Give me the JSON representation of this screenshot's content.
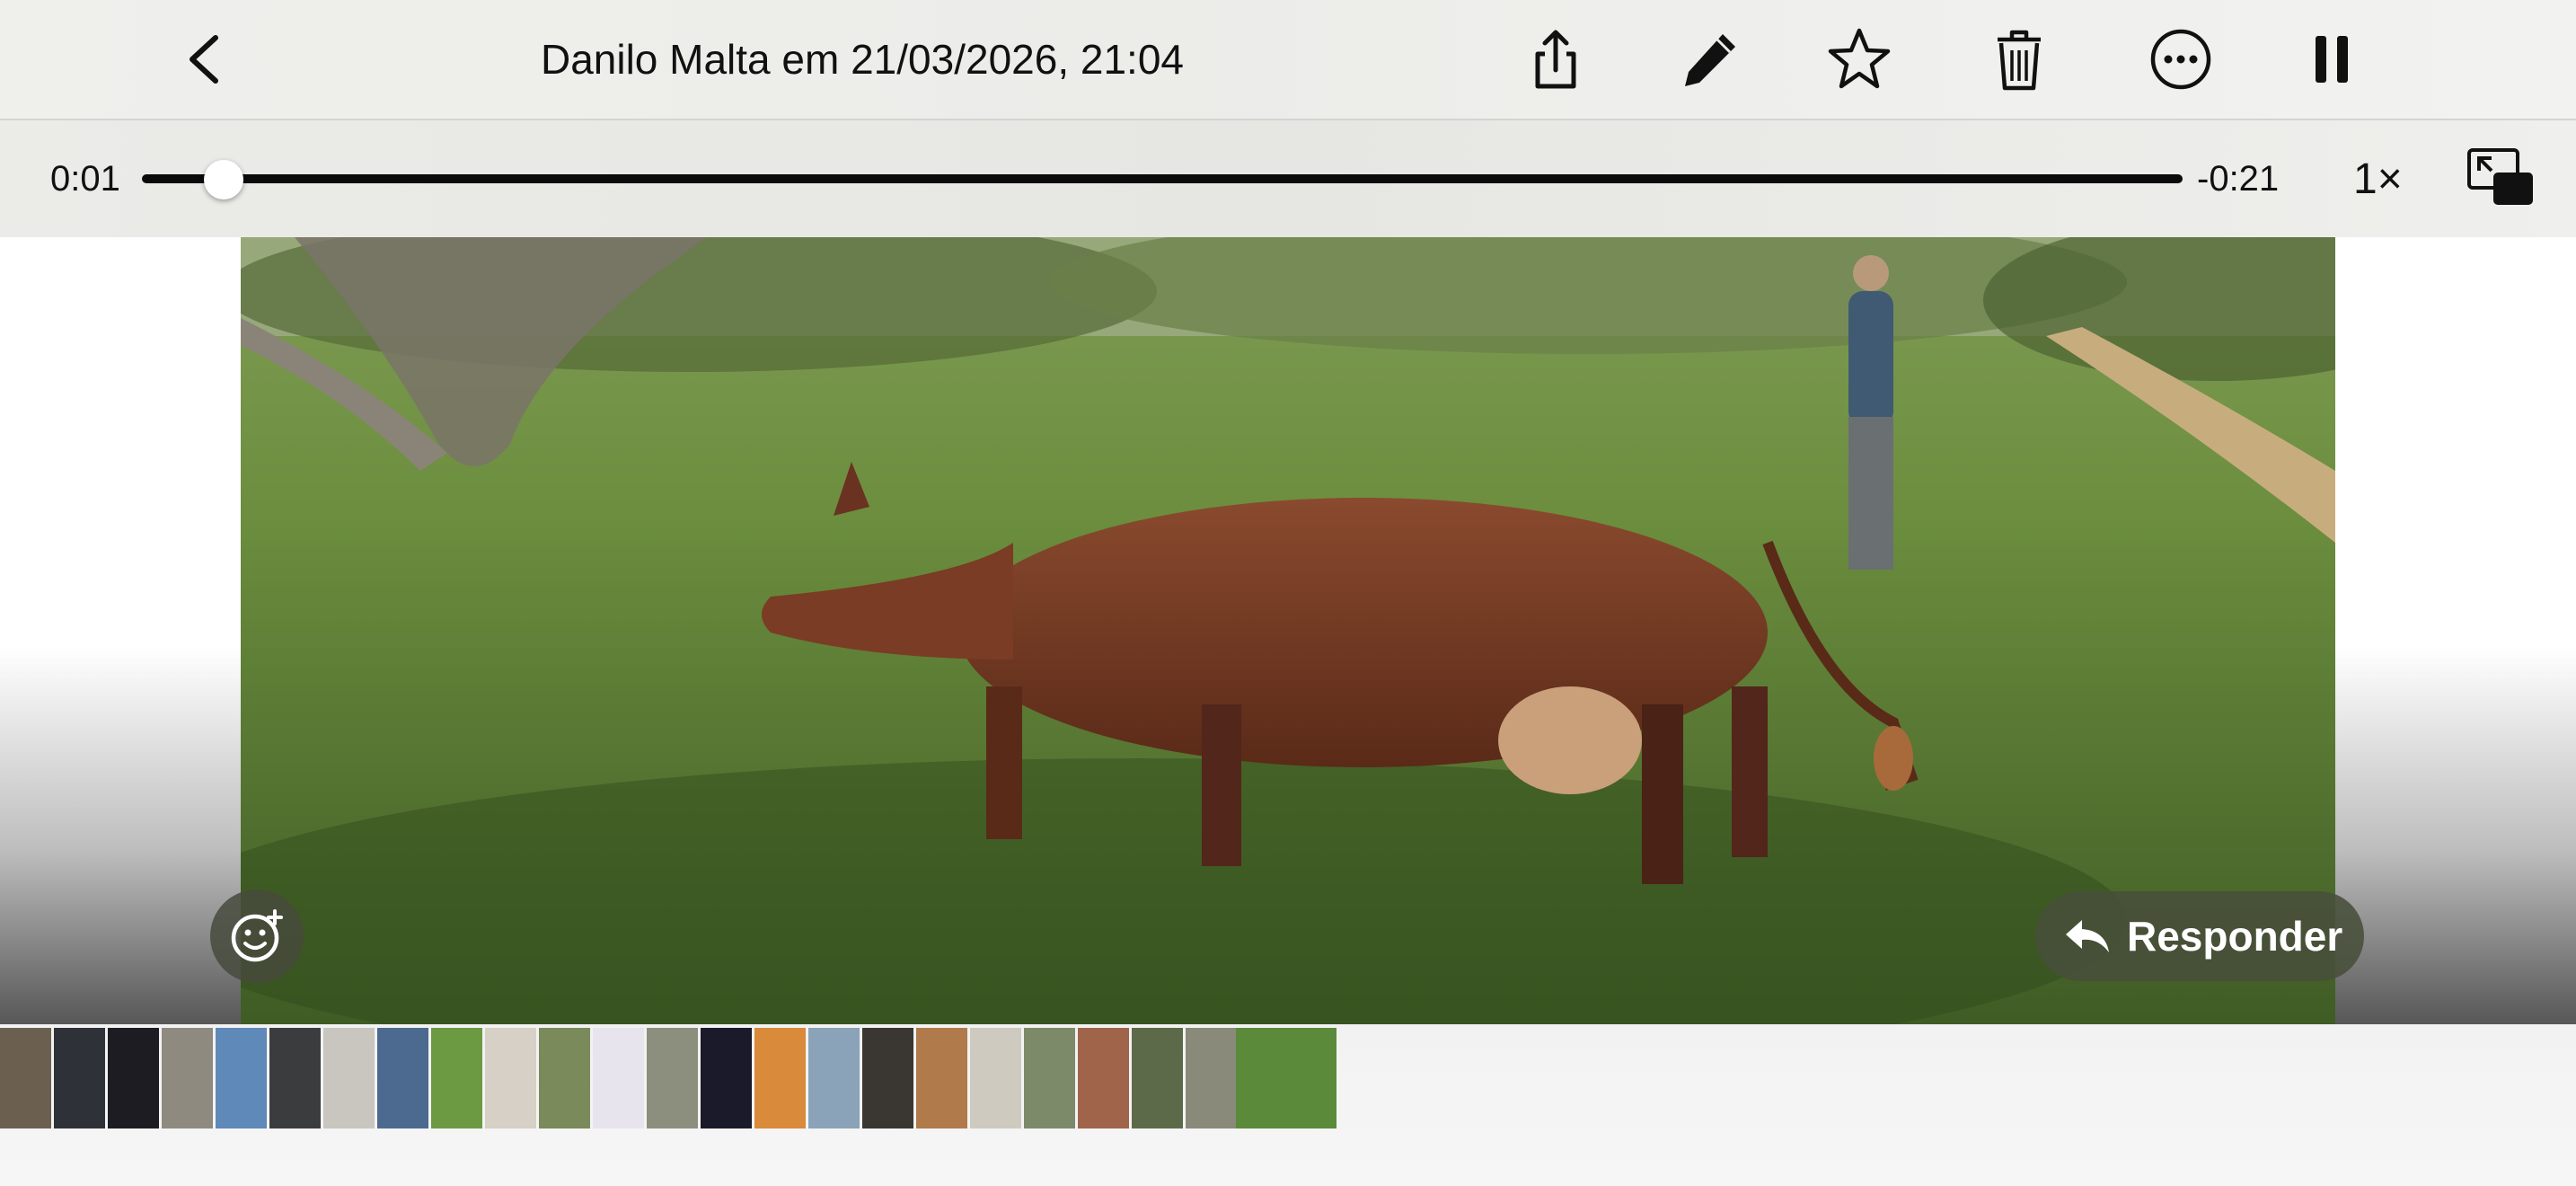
{
  "header": {
    "back_label": "Back",
    "title": "Danilo Malta em 21/03/2026, 21:04",
    "actions": [
      "share-icon",
      "edit-pencil-icon",
      "favorite-star-icon",
      "trash-icon",
      "more-ellipsis-icon",
      "pause-icon"
    ]
  },
  "player": {
    "elapsed": "0:01",
    "remaining": "-0:21",
    "progress": 0.04,
    "speed": "1×",
    "pip_icon": "picture-in-picture-icon"
  },
  "overlay": {
    "reply_label": "Responder",
    "reply_icon": "reply-arrow-icon",
    "react_icon": "add-reaction-icon"
  },
  "strip": {
    "thumbs": [
      "#6b6050",
      "#2e3238",
      "#1c1c22",
      "#8e8a80",
      "#5f89b8",
      "#3a3c3e",
      "#c9c6c0",
      "#4c6a90",
      "#6b9a42",
      "#d6d0c6",
      "#7a8a5a",
      "#e8e4ee",
      "#8c8f7e",
      "#1a1a2a",
      "#d98a3a",
      "#8aa3b8",
      "#3a3632",
      "#b07a4a",
      "#cfcac0",
      "#7d8a6a",
      "#a0644a",
      "#5d6a4a",
      "#8a8a7a"
    ],
    "current": "#5b8a3a"
  }
}
